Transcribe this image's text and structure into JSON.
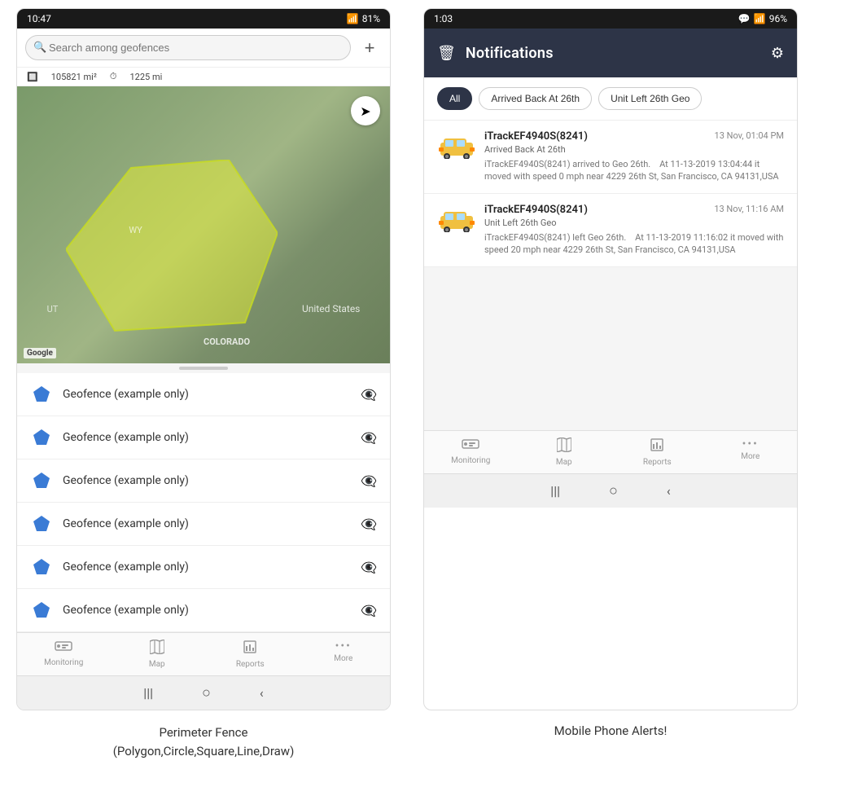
{
  "left_phone": {
    "status_bar": {
      "time": "10:47",
      "signal": "wifi",
      "bars": "▌▌▌",
      "battery": "81%"
    },
    "search": {
      "placeholder": "Search among geofences",
      "add_button": "+"
    },
    "stats": {
      "area": "105821 mi²",
      "distance": "1225 mi"
    },
    "map": {
      "labels": [
        "WY",
        "COLORADO",
        "UT",
        "United States"
      ],
      "google": "Google"
    },
    "geofence_items": [
      "Geofence (example only)",
      "Geofence (example only)",
      "Geofence (example only)",
      "Geofence (example only)",
      "Geofence (example only)",
      "Geofence (example only)"
    ],
    "nav": {
      "items": [
        {
          "icon": "🚌",
          "label": "Monitoring"
        },
        {
          "icon": "🗺",
          "label": "Map"
        },
        {
          "icon": "📊",
          "label": "Reports"
        },
        {
          "icon": "···",
          "label": "More"
        }
      ]
    },
    "android_nav": [
      "|||",
      "○",
      "<"
    ]
  },
  "right_phone": {
    "status_bar": {
      "time": "1:03",
      "battery": "96%"
    },
    "header": {
      "title": "Notifications",
      "delete_icon": "🗑",
      "settings_icon": "⚙"
    },
    "filter_tabs": [
      "All",
      "Arrived Back At 26th",
      "Unit Left 26th Geo"
    ],
    "notifications": [
      {
        "device": "iTrackEF4940S(8241)",
        "time": "13 Nov, 01:04 PM",
        "event": "Arrived Back At 26th",
        "description": "iTrackEF4940S(8241) arrived to Geo 26th.   At 11-13-2019 13:04:44 it moved with speed 0 mph near 4229 26th St, San Francisco, CA 94131,USA"
      },
      {
        "device": "iTrackEF4940S(8241)",
        "time": "13 Nov, 11:16 AM",
        "event": "Unit Left 26th Geo",
        "description": "iTrackEF4940S(8241) left Geo 26th.   At 11-13-2019 11:16:02 it moved with speed 20 mph near 4229 26th St, San Francisco, CA 94131,USA"
      }
    ],
    "nav": {
      "items": [
        {
          "icon": "🚌",
          "label": "Monitoring"
        },
        {
          "icon": "🗺",
          "label": "Map"
        },
        {
          "icon": "📊",
          "label": "Reports"
        },
        {
          "icon": "···",
          "label": "More"
        }
      ]
    },
    "android_nav": [
      "|||",
      "○",
      "<"
    ]
  },
  "captions": {
    "left": "Perimeter Fence\n(Polygon,Circle,Square,Line,Draw)",
    "right": "Mobile Phone Alerts!"
  }
}
